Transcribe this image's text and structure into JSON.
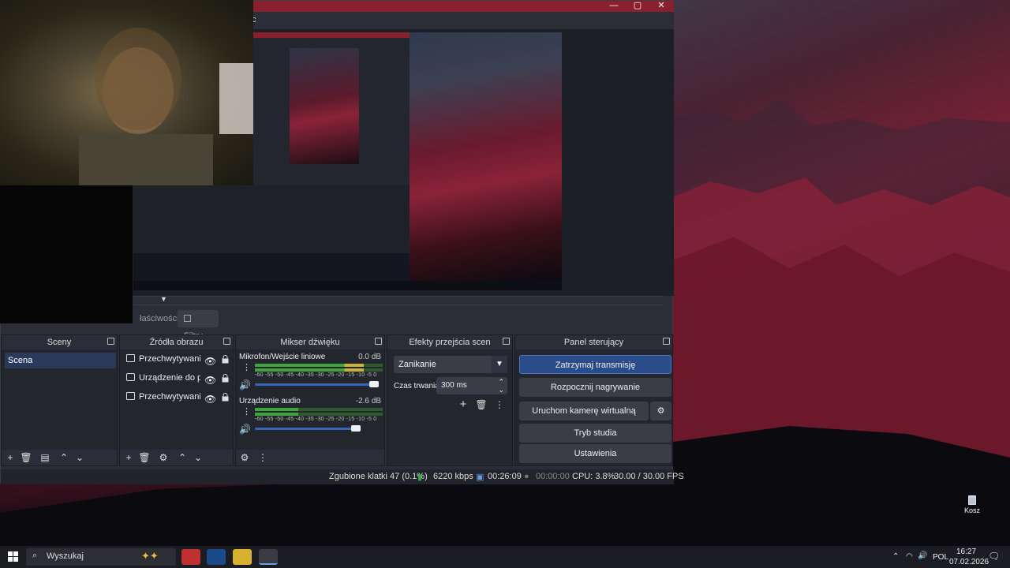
{
  "obs": {
    "menu_fragment": "c",
    "window_controls": {
      "minimize": "—",
      "maximize": "▢",
      "close": "✕"
    },
    "tabs": {
      "properties": "łaściwości",
      "filters": "Filtry"
    },
    "docks": {
      "scenes": {
        "title": "Sceny",
        "items": [
          "Scena"
        ]
      },
      "sources": {
        "title": "Źródła obrazu",
        "items": [
          {
            "label": "Przechwytywanie o",
            "icon": "window-capture-icon"
          },
          {
            "label": "Urządzenie do prze",
            "icon": "camera-icon"
          },
          {
            "label": "Przechwytywanie e",
            "icon": "monitor-icon"
          }
        ]
      },
      "mixer": {
        "title": "Mikser dźwięku",
        "channels": [
          {
            "name": "Mikrofon/Wejście liniowe",
            "db": "0.0 dB",
            "level": 0.85,
            "volume": 0.97
          },
          {
            "name": "Urządzenie audio",
            "db": "-2.6 dB",
            "level": 0.34,
            "volume": 0.83
          }
        ],
        "scale": "-60 -55 -50 -45 -40 -35 -30 -25 -20 -15 -10 -5 0"
      },
      "transitions": {
        "title": "Efekty przejścia scen",
        "selected": "Zanikanie",
        "duration_label": "Czas trwania",
        "duration_value": "300 ms"
      },
      "controls": {
        "title": "Panel sterujący",
        "buttons": [
          "Zatrzymaj transmisję",
          "Rozpocznij nagrywanie",
          "Uruchom kamerę wirtualną",
          "Tryb studia",
          "Ustawienia"
        ]
      }
    },
    "status": {
      "dropped": "Zgubione klatki 47 (0.1%)",
      "bitrate": "6220 kbps",
      "stream_time": "00:26:09",
      "rec_time": "00:00:00",
      "cpu": "CPU: 3.8%",
      "fps": "30.00 / 30.00 FPS"
    },
    "colors": {
      "accent": "#2a4d8a",
      "titlebar": "#8a1f2e",
      "meter_green": "#3fa63f",
      "meter_yellow": "#c9b43a",
      "meter_red": "#c0392b"
    }
  },
  "desktop": {
    "recycle_bin": "Kosz"
  },
  "taskbar": {
    "search_placeholder": "Wyszukaj",
    "language": "POL",
    "time": "16:27",
    "date": "07.02.2026",
    "apps": [
      "brave-icon",
      "steam-icon",
      "folder-icon",
      "obs-icon"
    ]
  }
}
